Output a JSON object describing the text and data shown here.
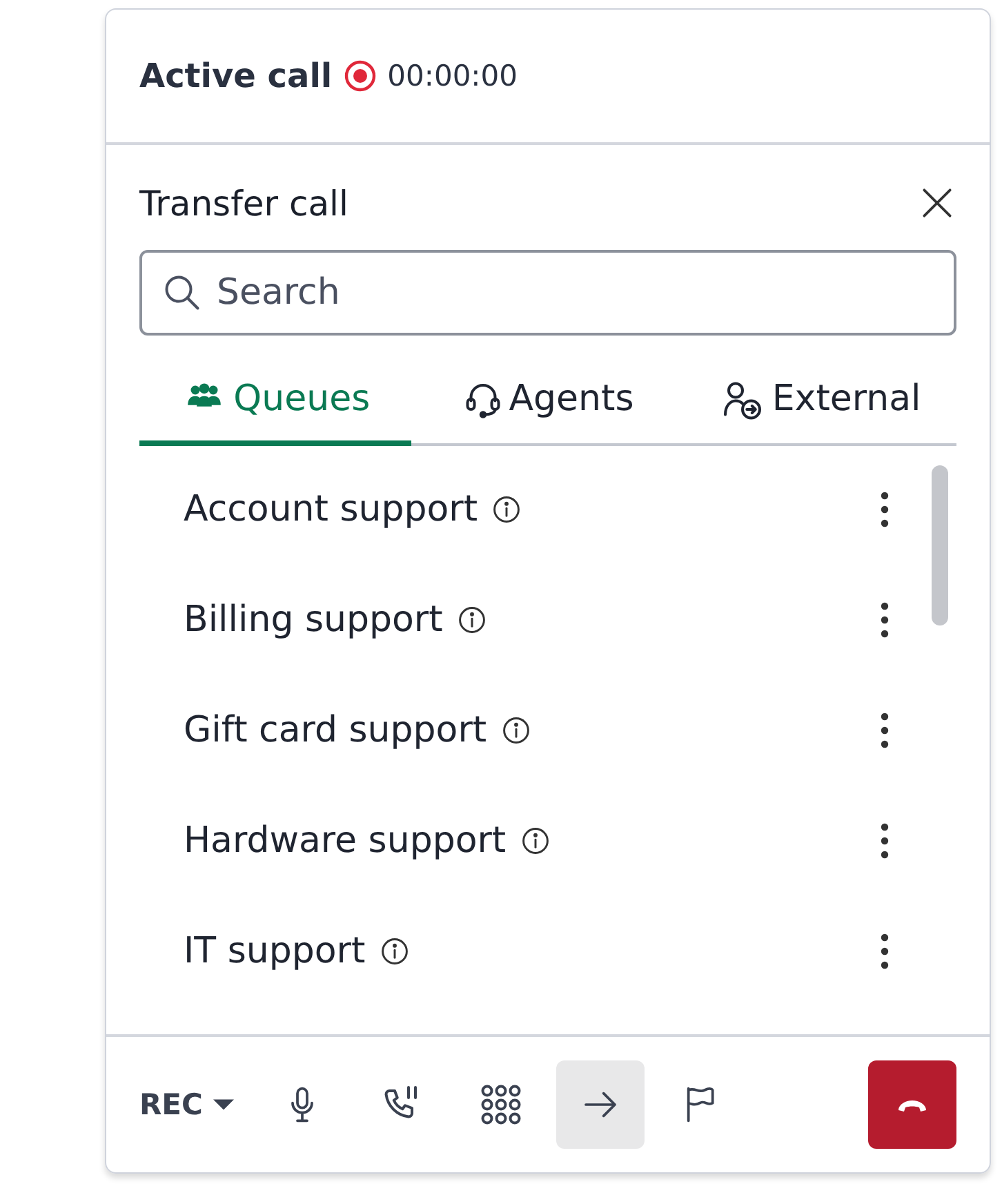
{
  "header": {
    "title": "Active call",
    "recording": true,
    "timer": "00:00:00"
  },
  "panel": {
    "title": "Transfer call",
    "search": {
      "placeholder": "Search"
    },
    "tabs": [
      {
        "label": "Queues",
        "kind": "queues",
        "selected": true
      },
      {
        "label": "Agents",
        "kind": "agents",
        "selected": false
      },
      {
        "label": "External",
        "kind": "external",
        "selected": false
      }
    ],
    "items": [
      {
        "name": "Account support"
      },
      {
        "name": "Billing support"
      },
      {
        "name": "Gift card support"
      },
      {
        "name": "Hardware support"
      },
      {
        "name": "IT support"
      }
    ]
  },
  "toolbar": [
    {
      "kind": "rec",
      "label": "REC",
      "selected": false
    },
    {
      "kind": "mic",
      "selected": false
    },
    {
      "kind": "hold",
      "selected": false
    },
    {
      "kind": "keypad",
      "selected": false
    },
    {
      "kind": "transfer",
      "selected": true
    },
    {
      "kind": "flag",
      "selected": false
    },
    {
      "kind": "hangup"
    }
  ]
}
